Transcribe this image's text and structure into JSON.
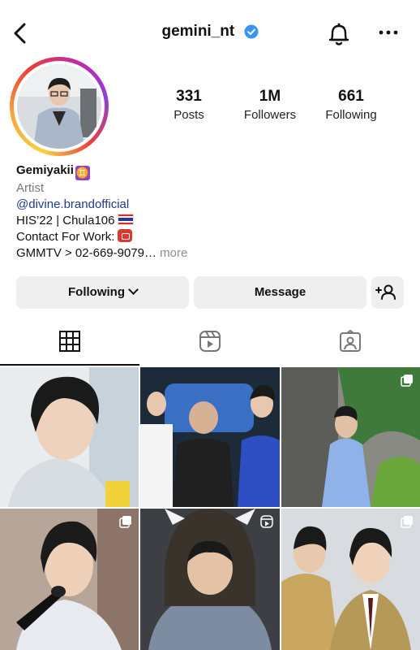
{
  "header": {
    "username": "gemini_nt",
    "back_icon": "chevron-left-icon",
    "verified_icon": "verified-badge-icon",
    "notification_icon": "bell-icon",
    "more_icon": "more-horizontal-icon"
  },
  "stats": {
    "posts": {
      "value": "331",
      "label": "Posts"
    },
    "followers": {
      "value": "1M",
      "label": "Followers"
    },
    "following": {
      "value": "661",
      "label": "Following"
    }
  },
  "bio": {
    "display_name": "Gemiyakii",
    "display_name_emoji": "♊",
    "category": "Artist",
    "link": "@divine.brandofficial",
    "line1": "HIS’22 | Chula106",
    "line2": "Contact For Work:",
    "line3": "GMMTV > 02-669-9079…",
    "more": " more"
  },
  "actions": {
    "following_label": "Following",
    "message_label": "Message",
    "add_user_icon": "add-user-icon"
  },
  "tabs": [
    {
      "name": "grid",
      "icon": "grid-icon",
      "selected": true
    },
    {
      "name": "reels",
      "icon": "reels-icon",
      "selected": false
    },
    {
      "name": "tagged",
      "icon": "tagged-icon",
      "selected": false
    }
  ],
  "colors": {
    "verified": "#3897f0",
    "link": "#1f3b8a",
    "button_bg": "#efefef",
    "muted": "#8e8e8e"
  }
}
